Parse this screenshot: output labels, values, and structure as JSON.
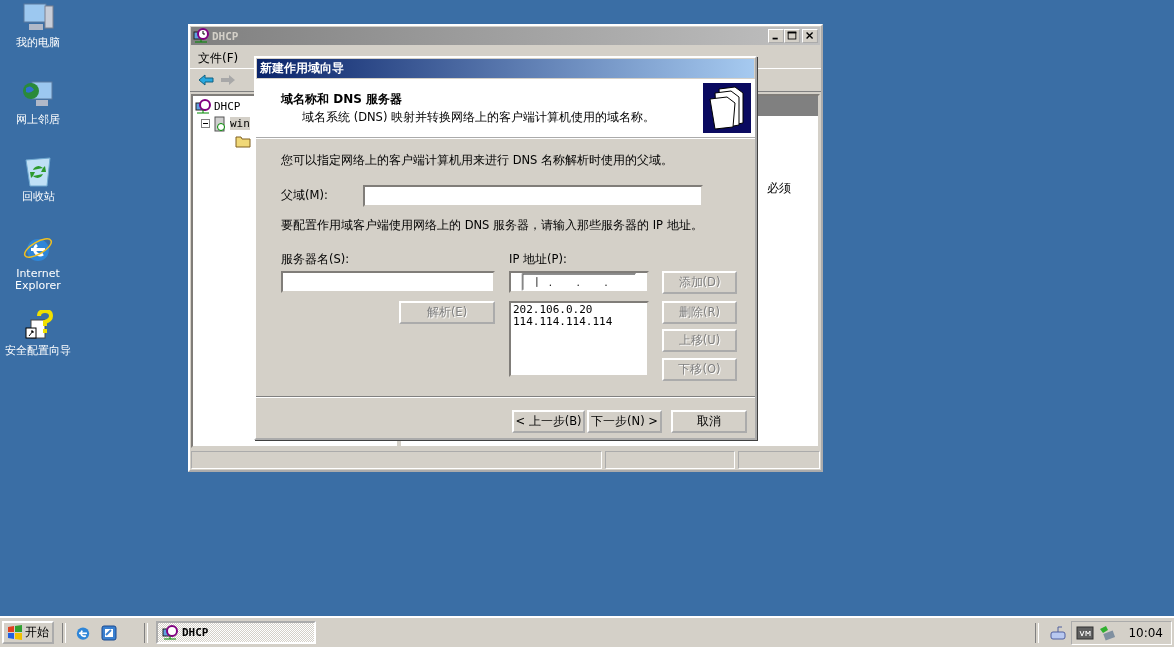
{
  "desktop_icons": [
    {
      "label": "我的电脑",
      "kind": "computer"
    },
    {
      "label": "网上邻居",
      "kind": "network"
    },
    {
      "label": "回收站",
      "kind": "recycle"
    },
    {
      "label": "Internet Explorer",
      "kind": "ie"
    },
    {
      "label": "安全配置向导",
      "kind": "wizard"
    }
  ],
  "main_window": {
    "title": "DHCP",
    "menu": [
      "文件(F)"
    ],
    "tree": [
      {
        "label": "DHCP",
        "children": [
          {
            "label": "win",
            "expanded": true
          }
        ]
      }
    ],
    "pane_text": "必须"
  },
  "dialog": {
    "title": "新建作用域向导",
    "heading": "域名称和 DNS 服务器",
    "subheading": "域名系统 (DNS) 映射并转换网络上的客户端计算机使用的域名称。",
    "intro": "您可以指定网络上的客户端计算机用来进行 DNS 名称解析时使用的父域。",
    "parent_domain_label": "父域(M):",
    "dns_note": "要配置作用域客户端使用网络上的 DNS 服务器，请输入那些服务器的 IP 地址。",
    "server_name_label": "服务器名(S):",
    "ip_label": "IP 地址(P):",
    "resolve_button": {
      "label": "解析(E)",
      "disabled": true
    },
    "ip_list": [
      "202.106.0.20",
      "114.114.114.114"
    ],
    "side_buttons": [
      {
        "label": "添加(D)",
        "disabled": true
      },
      {
        "label": "删除(R)",
        "disabled": true
      },
      {
        "label": "上移(U)",
        "disabled": true
      },
      {
        "label": "下移(O)",
        "disabled": true
      }
    ],
    "nav_buttons": [
      {
        "label": "< 上一步(B)",
        "disabled": false
      },
      {
        "label": "下一步(N) >",
        "disabled": false
      },
      {
        "label": "取消",
        "disabled": false
      }
    ]
  },
  "taskbar": {
    "start": "开始",
    "tasks": [
      {
        "label": "DHCP",
        "selected": true
      }
    ],
    "clock": "10:04"
  }
}
